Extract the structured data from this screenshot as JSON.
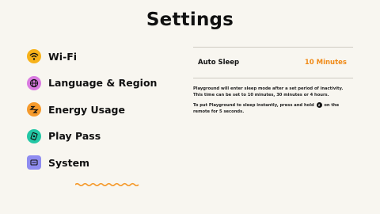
{
  "page": {
    "title": "Settings"
  },
  "menu": {
    "items": [
      {
        "label": "Wi-Fi",
        "icon": "wifi-icon",
        "color": "#f7b21a"
      },
      {
        "label": "Language & Region",
        "icon": "globe-icon",
        "color": "#d97be0"
      },
      {
        "label": "Energy Usage",
        "icon": "energy-zz-icon",
        "color": "#f59a2c",
        "selected": true
      },
      {
        "label": "Play Pass",
        "icon": "play-pass-icon",
        "color": "#23c7a5"
      },
      {
        "label": "System",
        "icon": "system-icon",
        "color": "#8f8cf0"
      }
    ],
    "accent": "#f59a2c"
  },
  "panel": {
    "setting_label": "Auto Sleep",
    "setting_value": "10 Minutes",
    "desc1": "Playground will enter sleep mode after a set period of inactivity. This time can be set to 10 minutes, 30 minutes or 4 hours.",
    "desc2_pre": "To put Playground to sleep instantly, press and hold",
    "desc2_post": "on the remote for 5 seconds.",
    "button_glyph": "zz-button-icon"
  }
}
